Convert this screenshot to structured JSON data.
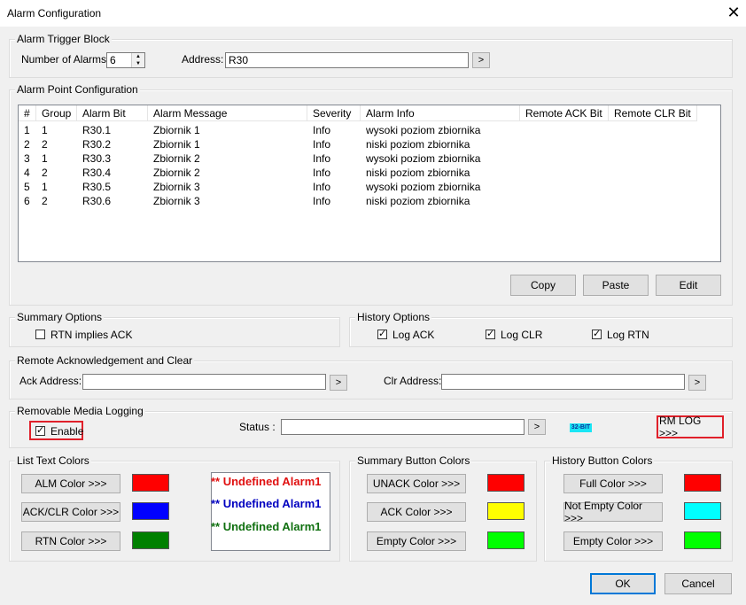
{
  "window": {
    "title": "Alarm Configuration",
    "close_glyph": "✕"
  },
  "trigger_block": {
    "legend": "Alarm Trigger Block",
    "num_alarms_label": "Number of Alarms:",
    "num_alarms_value": "6",
    "address_label": "Address:",
    "address_value": "R30",
    "browse_label": ">"
  },
  "point_config": {
    "legend": "Alarm Point Configuration",
    "columns": [
      "#",
      "Group",
      "Alarm Bit",
      "Alarm Message",
      "Severity",
      "Alarm Info",
      "Remote ACK Bit",
      "Remote CLR Bit"
    ],
    "rows": [
      [
        "1",
        "1",
        "R30.1",
        "Zbiornik 1",
        "Info",
        "wysoki poziom zbiornika",
        "",
        ""
      ],
      [
        "2",
        "2",
        "R30.2",
        "Zbiornik 1",
        "Info",
        "niski poziom zbiornika",
        "",
        ""
      ],
      [
        "3",
        "1",
        "R30.3",
        "Zbiornik 2",
        "Info",
        "wysoki poziom zbiornika",
        "",
        ""
      ],
      [
        "4",
        "2",
        "R30.4",
        "Zbiornik 2",
        "Info",
        "niski poziom zbiornika",
        "",
        ""
      ],
      [
        "5",
        "1",
        "R30.5",
        "Zbiornik 3",
        "Info",
        "wysoki poziom zbiornika",
        "",
        ""
      ],
      [
        "6",
        "2",
        "R30.6",
        "Zbiornik 3",
        "Info",
        "niski poziom zbiornika",
        "",
        ""
      ]
    ],
    "copy_label": "Copy",
    "paste_label": "Paste",
    "edit_label": "Edit"
  },
  "summary_options": {
    "legend": "Summary Options",
    "rtn_implies_ack_label": "RTN implies ACK",
    "rtn_implies_ack_checked": false
  },
  "history_options": {
    "legend": "History Options",
    "log_ack_label": "Log ACK",
    "log_ack_checked": true,
    "log_clr_label": "Log CLR",
    "log_clr_checked": true,
    "log_rtn_label": "Log RTN",
    "log_rtn_checked": true
  },
  "remote_ack": {
    "legend": "Remote Acknowledgement and Clear",
    "ack_label": "Ack Address:",
    "ack_value": "",
    "clr_label": "Clr Address:",
    "clr_value": "",
    "browse_label": ">"
  },
  "media_logging": {
    "legend": "Removable Media Logging",
    "enable_label": "Enable",
    "enable_checked": true,
    "status_label": "Status :",
    "status_value": "",
    "browse_label": ">",
    "badge_text": "32-BIT",
    "rm_log_label": "RM LOG >>>"
  },
  "list_text_colors": {
    "legend": "List Text Colors",
    "alm_label": "ALM Color >>>",
    "alm_color": "#ff0000",
    "ackclr_label": "ACK/CLR Color >>>",
    "ackclr_color": "#0000ff",
    "rtn_label": "RTN Color >>>",
    "rtn_color": "#008000",
    "preview": [
      {
        "text": "** Undefined Alarm1",
        "color": "#e01010"
      },
      {
        "text": "** Undefined Alarm1",
        "color": "#0000c0"
      },
      {
        "text": "** Undefined Alarm1",
        "color": "#107010"
      }
    ]
  },
  "summary_button_colors": {
    "legend": "Summary Button Colors",
    "unack_label": "UNACK Color >>>",
    "unack_color": "#ff0000",
    "ack_label": "ACK Color >>>",
    "ack_color": "#ffff00",
    "empty_label": "Empty Color >>>",
    "empty_color": "#00ff00"
  },
  "history_button_colors": {
    "legend": "History Button Colors",
    "full_label": "Full Color >>>",
    "full_color": "#ff0000",
    "notempty_label": "Not Empty Color >>>",
    "notempty_color": "#00ffff",
    "empty_label": "Empty Color >>>",
    "empty_color": "#00ff00"
  },
  "footer": {
    "ok_label": "OK",
    "cancel_label": "Cancel"
  }
}
